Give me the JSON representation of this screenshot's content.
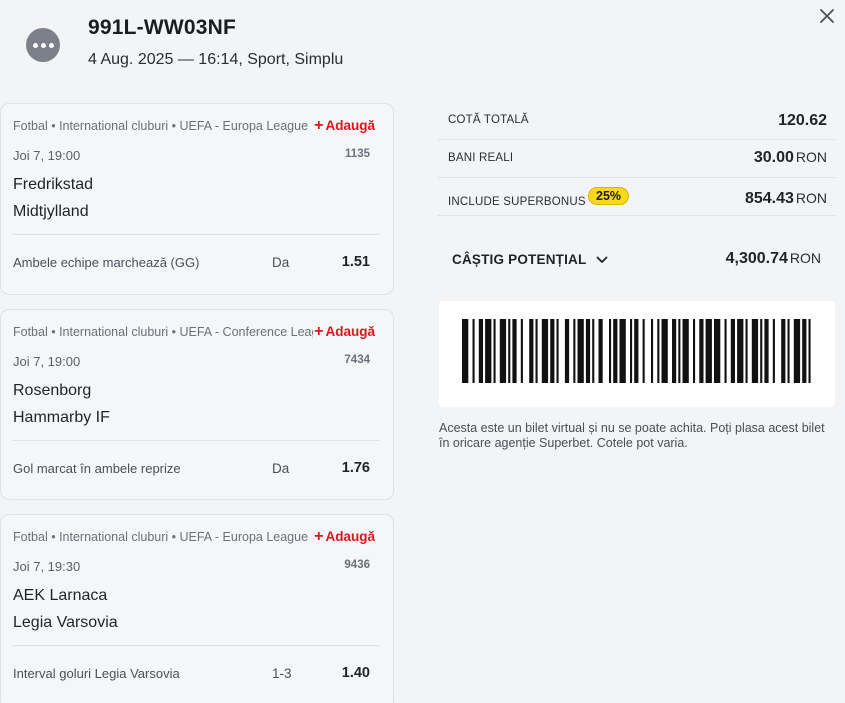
{
  "header": {
    "ticket_id": "991L-WW03NF",
    "meta": "4 Aug. 2025 — 16:14, Sport, Simplu"
  },
  "icons": {
    "menu": "more-horizontal-icon",
    "close": "close-icon",
    "add": "plus-icon",
    "expand": "chevron-down-icon"
  },
  "events": [
    {
      "path": "Fotbal • International cluburi • UEFA - Europa League",
      "add_label": "Adaugă",
      "date": "Joi 7, 19:00",
      "code": "1135",
      "home": "Fredrikstad",
      "away": "Midtjylland",
      "market": "Ambele echipe marchează (GG)",
      "pick": "Da",
      "odds": "1.51"
    },
    {
      "path": "Fotbal • International cluburi • UEFA - Conference League",
      "add_label": "Adaugă",
      "date": "Joi 7, 19:00",
      "code": "7434",
      "home": "Rosenborg",
      "away": "Hammarby IF",
      "market": "Gol marcat în ambele reprize",
      "pick": "Da",
      "odds": "1.76"
    },
    {
      "path": "Fotbal • International cluburi • UEFA - Europa League",
      "add_label": "Adaugă",
      "date": "Joi 7, 19:30",
      "code": "9436",
      "home": "AEK Larnaca",
      "away": "Legia Varsovia",
      "market": "Interval goluri Legia Varsovia",
      "pick": "1-3",
      "odds": "1.40"
    }
  ],
  "summary": {
    "total_odds_label": "COTĂ TOTALĂ",
    "total_odds": "120.62",
    "real_money_label": "BANI REALI",
    "real_money": "30.00",
    "superbonus_label": "INCLUDE SUPERBONUS",
    "superbonus_badge": "25%",
    "superbonus_value": "854.43",
    "currency": "RON",
    "potential_label": "CÂȘTIG POTENȚIAL",
    "potential_value": "4,300.74"
  },
  "disclaimer": "Acesta este un bilet virtual și nu se poate achita. Poți plasa acest bilet în oricare agenție Superbet. Cotele pot varia.",
  "colors": {
    "accent_red": "#e0141e",
    "badge_yellow": "#f9d71c",
    "background": "#f3f4f6"
  }
}
